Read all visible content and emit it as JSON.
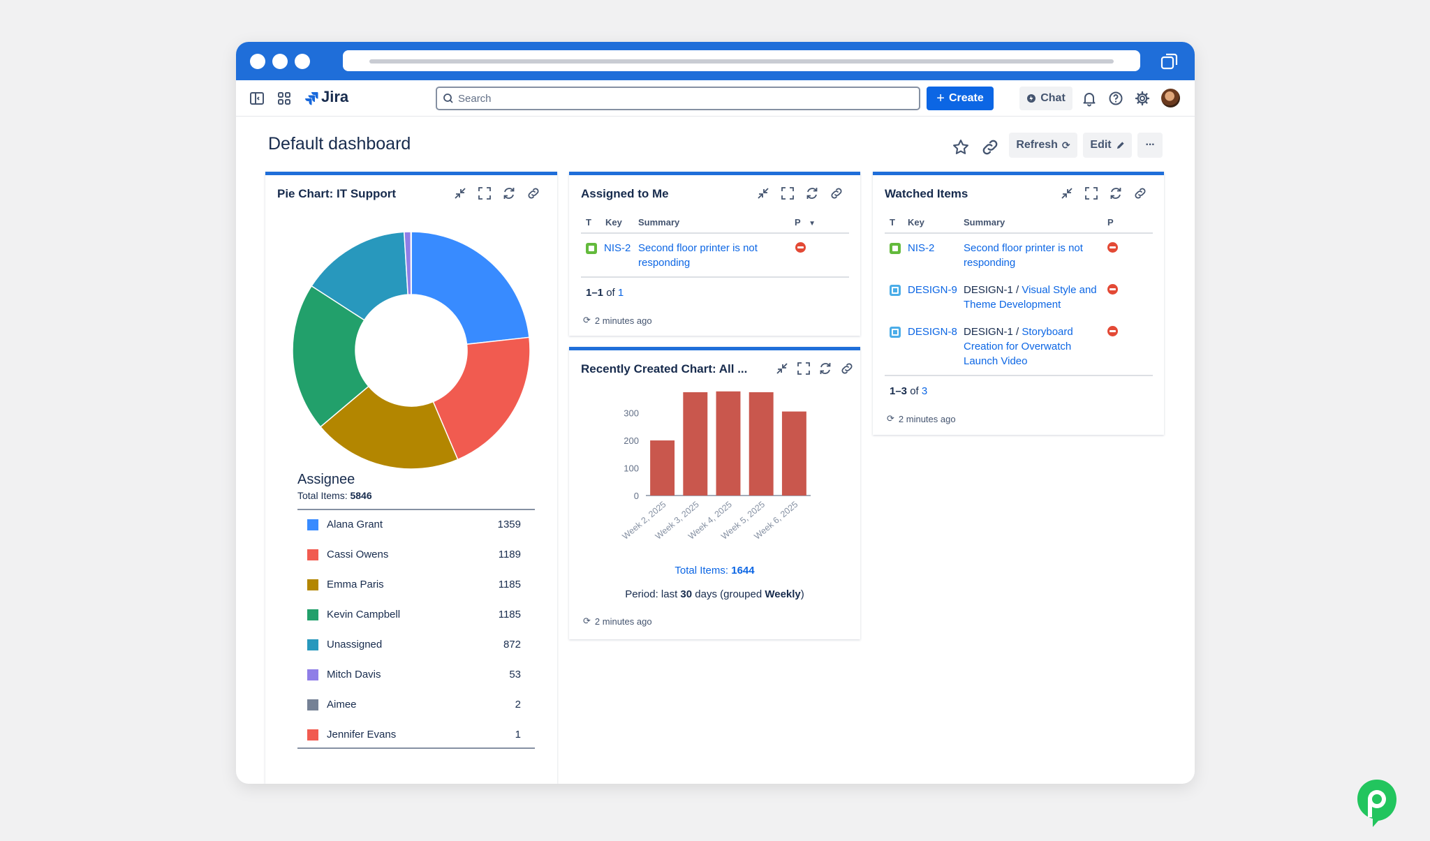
{
  "app": {
    "name": "Jira"
  },
  "search": {
    "placeholder": "Search"
  },
  "topnav": {
    "create_label": "Create",
    "chat_label": "Chat"
  },
  "dashboard": {
    "title": "Default dashboard",
    "refresh_label": "Refresh",
    "edit_label": "Edit",
    "more_label": "···"
  },
  "pie_gadget": {
    "title": "Pie Chart: IT Support",
    "legend_title": "Assignee",
    "total_label": "Total Items: ",
    "total_value": "5846",
    "items": [
      {
        "name": "Alana Grant",
        "count": "1359",
        "color": "#388bff"
      },
      {
        "name": "Cassi Owens",
        "count": "1189",
        "color": "#f15b50"
      },
      {
        "name": "Emma Paris",
        "count": "1185",
        "color": "#b38600"
      },
      {
        "name": "Kevin Campbell",
        "count": "1185",
        "color": "#22a06b"
      },
      {
        "name": "Unassigned",
        "count": "872",
        "color": "#2898bd"
      },
      {
        "name": "Mitch Davis",
        "count": "53",
        "color": "#8f7ee7"
      },
      {
        "name": "Aimee",
        "count": "2",
        "color": "#758195"
      },
      {
        "name": "Jennifer Evans",
        "count": "1",
        "color": "#f15b50"
      }
    ]
  },
  "chart_data": {
    "type": "bar",
    "categories": [
      "Week 2, 2025",
      "Week 3, 2025",
      "Week 4, 2025",
      "Week 5, 2025",
      "Week 6, 2025"
    ],
    "values": [
      200,
      375,
      378,
      375,
      305
    ],
    "ylim": [
      0,
      380
    ],
    "yticks": [
      "0",
      "100",
      "200",
      "300"
    ],
    "bar_color": "#c9574d"
  },
  "assigned_gadget": {
    "title": "Assigned to Me",
    "headers": {
      "t": "T",
      "key": "Key",
      "summary": "Summary",
      "p": "P"
    },
    "row": {
      "key": "NIS-2",
      "summary": "Second floor printer is not responding"
    },
    "pager_prefix": "1–1",
    "pager_of": " of ",
    "pager_total": "1",
    "updated": "2 minutes ago"
  },
  "recent_gadget": {
    "title": "Recently Created Chart: All ...",
    "total_label": "Total Items: ",
    "total_value": "1644",
    "period_prefix": "Period: last ",
    "period_days": "30",
    "period_mid": " days (grouped ",
    "period_group": "Weekly",
    "period_suffix": ")",
    "updated": "2 minutes ago"
  },
  "watched_gadget": {
    "title": "Watched Items",
    "headers": {
      "t": "T",
      "key": "Key",
      "summary": "Summary",
      "p": "P"
    },
    "rows": [
      {
        "key": "NIS-2",
        "parent": "",
        "summary": "Second floor printer is not responding"
      },
      {
        "key": "DESIGN-9",
        "parent": "DESIGN-1 / ",
        "summary": "Visual Style and Theme Development"
      },
      {
        "key": "DESIGN-8",
        "parent": "DESIGN-1 / ",
        "summary": "Storyboard Creation for Overwatch Launch Video"
      }
    ],
    "pager_prefix": "1–3",
    "pager_of": " of ",
    "pager_total": "3",
    "updated": "2 minutes ago"
  }
}
